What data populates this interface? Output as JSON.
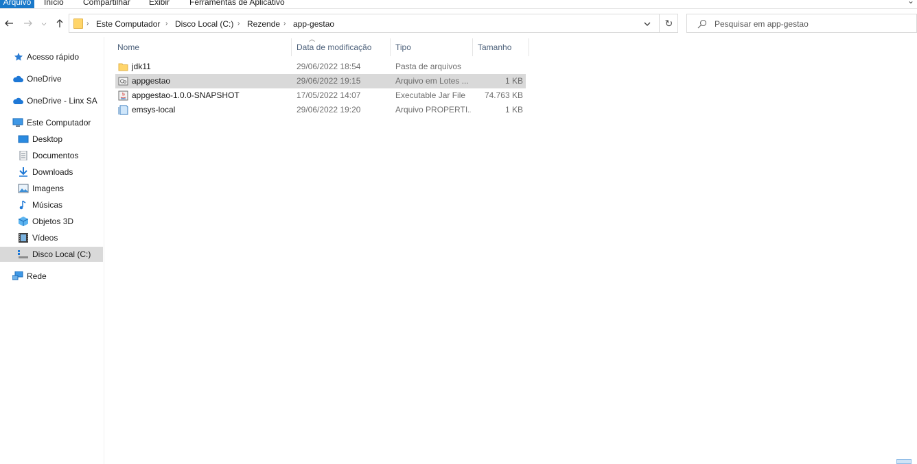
{
  "ribbon": {
    "tabs": [
      "Arquivo",
      "Início",
      "Compartilhar",
      "Exibir",
      "Ferramentas de Aplicativo"
    ],
    "accent": "#1979ca"
  },
  "address": {
    "breadcrumbs": [
      "Este Computador",
      "Disco Local (C:)",
      "Rezende",
      "app-gestao"
    ]
  },
  "search": {
    "placeholder": "Pesquisar em app-gestao"
  },
  "sidebar": {
    "items": [
      {
        "label": "Acesso rápido",
        "icon": "star-icon"
      },
      {
        "label": "OneDrive",
        "icon": "cloud-icon"
      },
      {
        "label": "OneDrive - Linx SA",
        "icon": "cloud-icon"
      },
      {
        "label": "Este Computador",
        "icon": "computer-icon"
      },
      {
        "label": "Desktop",
        "icon": "desktop-icon"
      },
      {
        "label": "Documentos",
        "icon": "document-icon"
      },
      {
        "label": "Downloads",
        "icon": "download-icon"
      },
      {
        "label": "Imagens",
        "icon": "image-icon"
      },
      {
        "label": "Músicas",
        "icon": "music-icon"
      },
      {
        "label": "Objetos 3D",
        "icon": "cube-icon"
      },
      {
        "label": "Vídeos",
        "icon": "video-icon"
      },
      {
        "label": "Disco Local (C:)",
        "icon": "drive-icon",
        "selected": true
      },
      {
        "label": "Rede",
        "icon": "network-icon"
      }
    ]
  },
  "columns": [
    "Nome",
    "Data de modificação",
    "Tipo",
    "Tamanho"
  ],
  "files": [
    {
      "name": "jdk11",
      "date": "29/06/2022 18:54",
      "type": "Pasta de arquivos",
      "size": "",
      "icon": "folder-icon"
    },
    {
      "name": "appgestao",
      "date": "29/06/2022 19:15",
      "type": "Arquivo em Lotes ...",
      "size": "1 KB",
      "icon": "batch-file-icon",
      "selected": true
    },
    {
      "name": "appgestao-1.0.0-SNAPSHOT",
      "date": "17/05/2022 14:07",
      "type": "Executable Jar File",
      "size": "74.763 KB",
      "icon": "jar-file-icon"
    },
    {
      "name": "emsys-local",
      "date": "29/06/2022 19:20",
      "type": "Arquivo PROPERTI...",
      "size": "1 KB",
      "icon": "properties-file-icon"
    }
  ]
}
